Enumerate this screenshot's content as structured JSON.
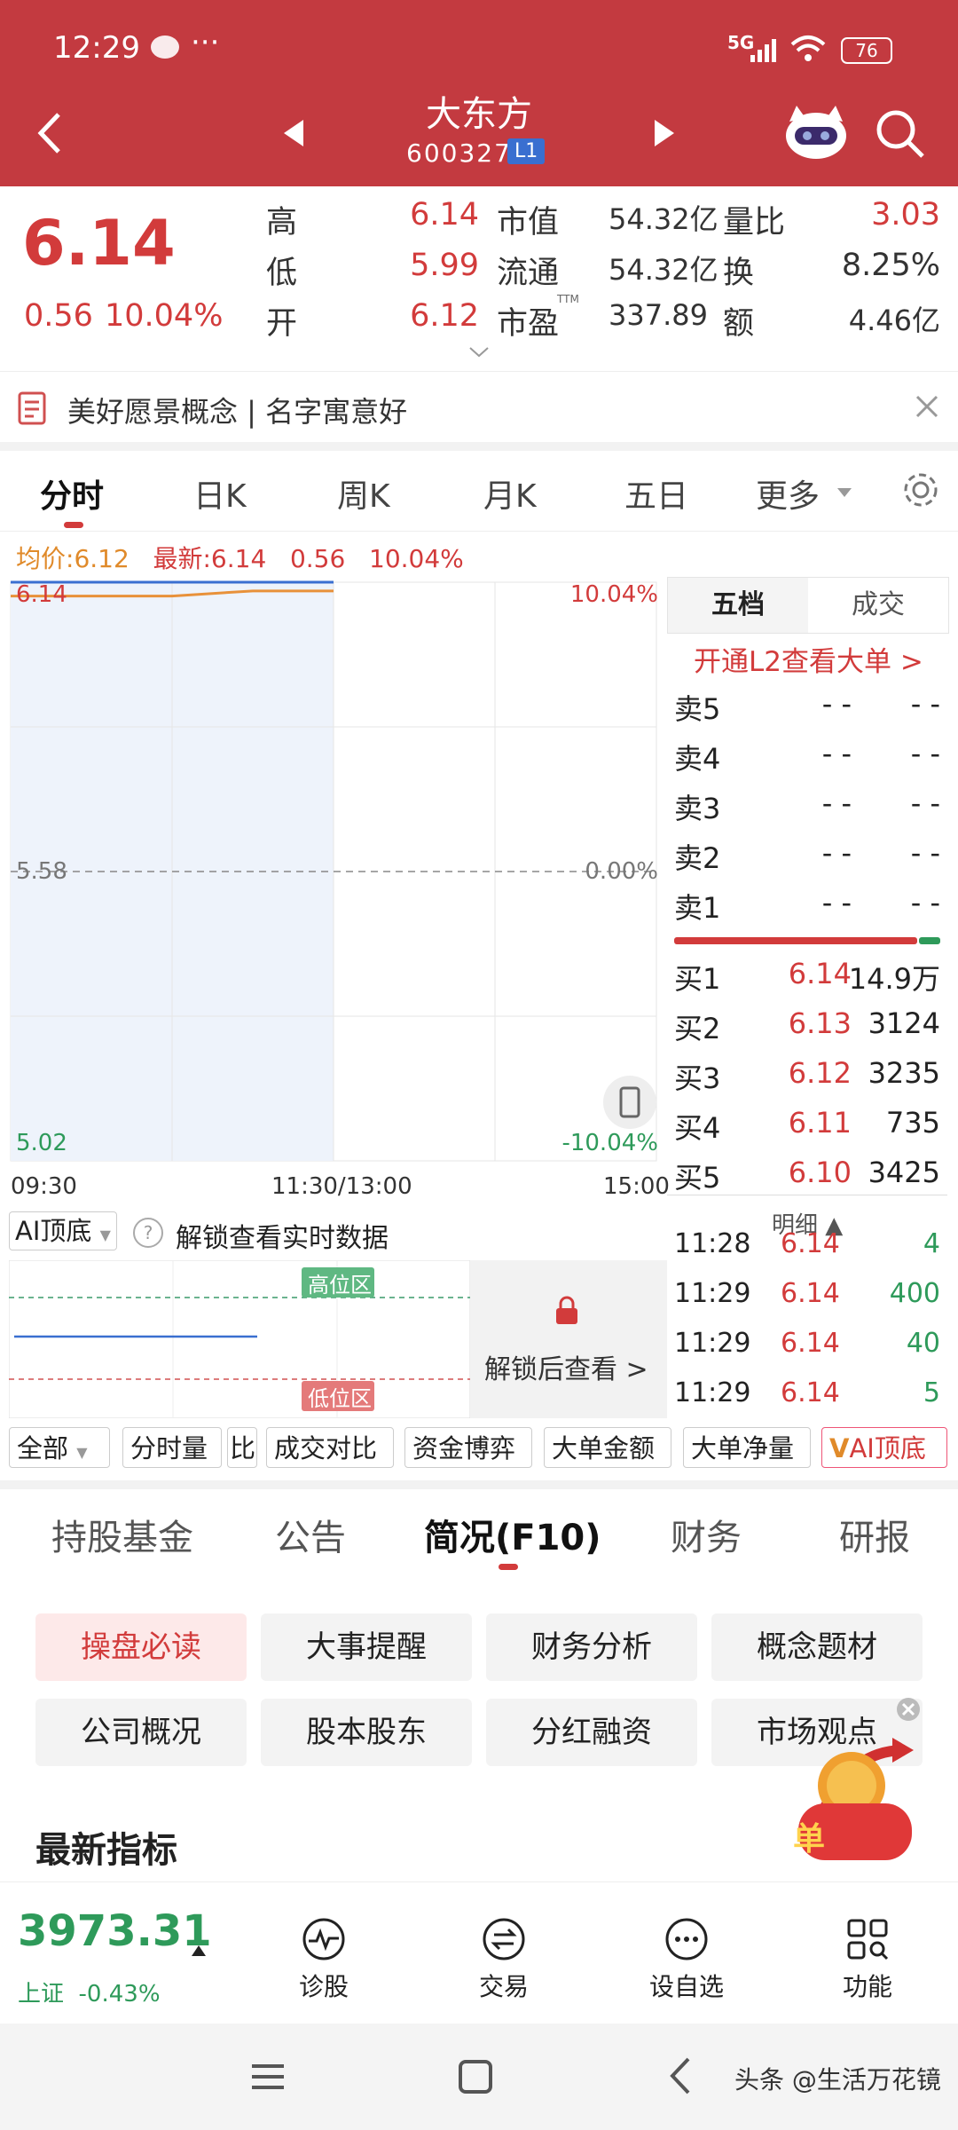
{
  "status_bar": {
    "time": "12:29",
    "dots": "···",
    "network": "5G",
    "battery": "76"
  },
  "header": {
    "stock_name": "大东方",
    "stock_code": "600327",
    "level_badge": "L1"
  },
  "quote": {
    "price": "6.14",
    "change": "0.56",
    "change_pct": "10.04%",
    "rows": [
      {
        "l1": "高",
        "v1": "6.14",
        "l2": "市值",
        "v2": "54.32亿",
        "l3": "量比",
        "v3": "3.03"
      },
      {
        "l1": "低",
        "v1": "5.99",
        "l2": "流通",
        "v2": "54.32亿",
        "l3": "换",
        "v3": "8.25%"
      },
      {
        "l1": "开",
        "v1": "6.12",
        "l2": "市盈",
        "l2_sup": "TTM",
        "v2": "337.89",
        "l3": "额",
        "v3": "4.46亿"
      }
    ]
  },
  "concept_banner": "美好愿景概念 | 名字寓意好",
  "chart_tabs": [
    "分时",
    "日K",
    "周K",
    "月K",
    "五日",
    "更多"
  ],
  "summary_line": {
    "avg_label": "均价:",
    "avg": "6.12",
    "latest_label": "最新:",
    "latest": "6.14",
    "chg": "0.56",
    "pct": "10.04%"
  },
  "chart_data": {
    "type": "line",
    "title": "",
    "xlabel": "",
    "ylabel": "",
    "x_ticks": [
      "09:30",
      "11:30/13:00",
      "15:00"
    ],
    "y_left_ticks": [
      "6.14",
      "5.58",
      "5.02"
    ],
    "y_right_ticks": [
      "10.04%",
      "0.00%",
      "-10.04%"
    ],
    "ylim": [
      5.02,
      6.14
    ],
    "series": [
      {
        "x": [
          "09:30",
          "10:00",
          "10:30",
          "11:00",
          "11:30"
        ],
        "values": [
          6.14,
          6.14,
          6.14,
          6.14,
          6.14
        ]
      },
      {
        "x": [
          "09:30",
          "10:00",
          "10:30",
          "11:00",
          "11:30"
        ],
        "values": [
          6.12,
          6.12,
          6.12,
          6.13,
          6.13
        ]
      }
    ],
    "reference_value": 5.58,
    "grid": true,
    "colors": {
      "price": "#3a6fd0",
      "avg": "#e8913a",
      "ref": "#888888"
    }
  },
  "orderbook": {
    "tabs": [
      "五档",
      "成交"
    ],
    "l2_link": "开通L2查看大单 >",
    "sells": [
      {
        "label": "卖5",
        "price": "- -",
        "vol": "- -"
      },
      {
        "label": "卖4",
        "price": "- -",
        "vol": "- -"
      },
      {
        "label": "卖3",
        "price": "- -",
        "vol": "- -"
      },
      {
        "label": "卖2",
        "price": "- -",
        "vol": "- -"
      },
      {
        "label": "卖1",
        "price": "- -",
        "vol": "- -"
      }
    ],
    "buys": [
      {
        "label": "买1",
        "price": "6.14",
        "vol": "14.9万"
      },
      {
        "label": "买2",
        "price": "6.13",
        "vol": "3124"
      },
      {
        "label": "买3",
        "price": "6.12",
        "vol": "3235"
      },
      {
        "label": "买4",
        "price": "6.11",
        "vol": "735"
      },
      {
        "label": "买5",
        "price": "6.10",
        "vol": "3425"
      }
    ],
    "detail_header": "明细 ▲",
    "ticks": [
      {
        "time": "11:28",
        "price": "6.14",
        "vol": "4"
      },
      {
        "time": "11:29",
        "price": "6.14",
        "vol": "400"
      },
      {
        "time": "11:29",
        "price": "6.14",
        "vol": "40"
      },
      {
        "time": "11:29",
        "price": "6.14",
        "vol": "5"
      }
    ]
  },
  "ai": {
    "dropdown": "AI顶底",
    "unlock_text": "解锁查看实时数据",
    "high_zone": "高位区",
    "low_zone": "低位区",
    "unlock_button": "解锁后查看 >"
  },
  "indicator_chips": [
    "全部",
    "分时量",
    "比",
    "成交对比",
    "资金博弈",
    "大单金额",
    "大单净量",
    "AI顶底"
  ],
  "bottom_tabs": [
    "持股基金",
    "公告",
    "简况(F10)",
    "财务",
    "研报"
  ],
  "f10_buttons": [
    "操盘必读",
    "大事提醒",
    "财务分析",
    "概念题材",
    "公司概况",
    "股本股东",
    "分红融资",
    "市场观点"
  ],
  "section_title": "最新指标",
  "index": {
    "value": "3973.31",
    "name": "上证",
    "pct": "-0.43%"
  },
  "bottom_nav": [
    "诊股",
    "交易",
    "设自选",
    "功能"
  ],
  "watermark": "头条 @生活万花镜"
}
